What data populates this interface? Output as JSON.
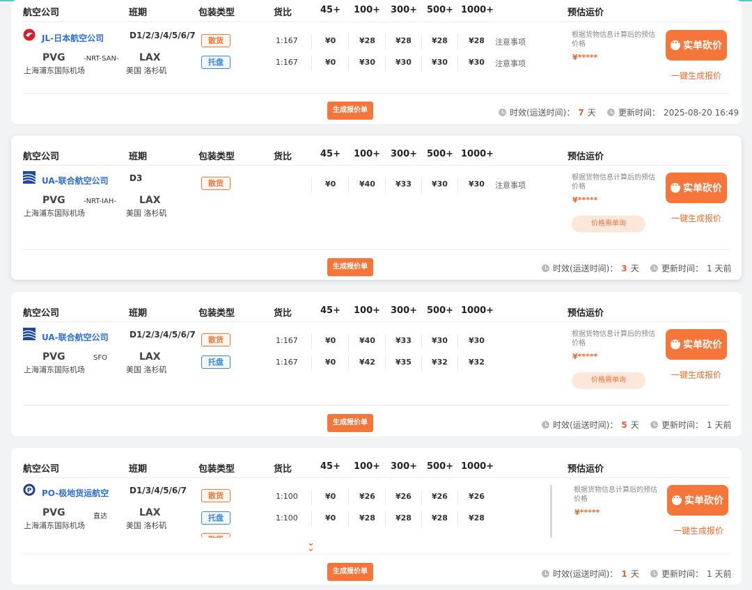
{
  "header": {
    "airline": "航空公司",
    "schedule": "班期",
    "pack_type": "包装类型",
    "ratio": "货比",
    "w45": "45+",
    "w100": "100+",
    "w300": "300+",
    "w500": "500+",
    "w1000": "1000+",
    "estimate": "预估运价"
  },
  "common": {
    "est_note": "根据货物信息计算后的预估价格",
    "stars": "¥*****",
    "bargain": "实单砍价",
    "one_click": "一键生成报价",
    "gen_quote": "生成报价单",
    "ask_price": "价格需单询",
    "transit_label": "时效(运送时间)：",
    "update_label": "更新时间：",
    "day_unit": "天",
    "origin_code": "PVG",
    "origin_name": "上海浦东国际机场",
    "dest_code": "LAX",
    "dest_name": "美国 洛杉矶",
    "tag_bulk": "散货",
    "tag_pallet": "托盘"
  },
  "colors": {
    "accent": "#f6763a",
    "link_blue": "#2b6fd6",
    "teal_line": "#5fc4c4"
  },
  "routes": [
    {
      "airline": "JL-日本航空公司",
      "logo_icon": "jal-crane-icon",
      "schedule": "D1/2/3/4/5/6/7",
      "via": "-NRT-SAN-",
      "transit_days": "7",
      "updated": "2025-08-20 16:49",
      "rows": [
        {
          "ratio": "1:167",
          "p45": "¥0",
          "p100": "¥28",
          "p300": "¥28",
          "p500": "¥28",
          "p1000": "¥28",
          "note": "注意事项"
        },
        {
          "ratio": "1:167",
          "p45": "¥0",
          "p100": "¥30",
          "p300": "¥30",
          "p500": "¥30",
          "p1000": "¥30",
          "note": "注意事项"
        }
      ]
    },
    {
      "airline": "UA-联合航空公司",
      "logo_icon": "united-globe-icon",
      "schedule": "D3",
      "via": "-NRT-IAH-",
      "transit_days": "3",
      "updated": "1 天前",
      "rows": [
        {
          "ratio": "",
          "p45": "¥0",
          "p100": "¥40",
          "p300": "¥33",
          "p500": "¥30",
          "p1000": "¥30",
          "note": "注意事项"
        }
      ]
    },
    {
      "airline": "UA-联合航空公司",
      "logo_icon": "united-globe-icon",
      "schedule": "D1/2/3/4/5/6/7",
      "via": "SFO",
      "transit_days": "5",
      "updated": "1 天前",
      "rows": [
        {
          "ratio": "1:167",
          "p45": "¥0",
          "p100": "¥40",
          "p300": "¥33",
          "p500": "¥30",
          "p1000": "¥30",
          "note": ""
        },
        {
          "ratio": "1:167",
          "p45": "¥0",
          "p100": "¥42",
          "p300": "¥35",
          "p500": "¥32",
          "p1000": "¥32",
          "note": ""
        }
      ]
    },
    {
      "airline": "PO-极地货运航空",
      "logo_icon": "polar-air-icon",
      "schedule": "D1/3/4/5/6/7",
      "via": "直达",
      "transit_days": "1",
      "updated": "1 天前",
      "rows": [
        {
          "ratio": "1:100",
          "p45": "¥0",
          "p100": "¥26",
          "p300": "¥26",
          "p500": "¥26",
          "p1000": "¥26",
          "note": ""
        },
        {
          "ratio": "1:100",
          "p45": "¥0",
          "p100": "¥28",
          "p300": "¥28",
          "p500": "¥28",
          "p1000": "¥28",
          "note": ""
        }
      ]
    }
  ]
}
